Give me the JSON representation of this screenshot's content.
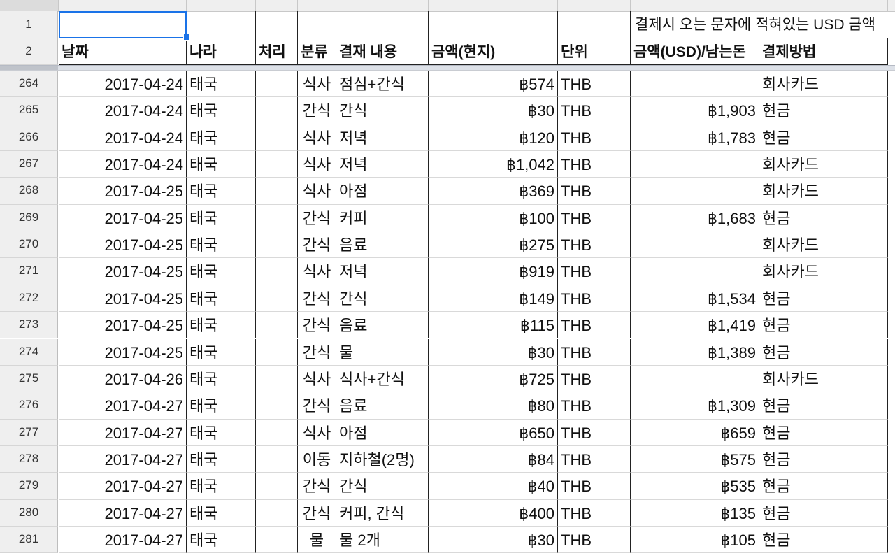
{
  "header_row_numbers": [
    "1",
    "2"
  ],
  "note_row1": "결제시 오는 문자에 적혀있는 USD 금액",
  "columns": [
    "날짜",
    "나라",
    "처리",
    "분류",
    "결재 내용",
    "금액(현지)",
    "단위",
    "금액(USD)/남는돈",
    "결제방법"
  ],
  "rows": [
    {
      "num": "264",
      "date": "2017-04-24",
      "country": "태국",
      "proc": "",
      "cat": "식사",
      "desc": "점심+간식",
      "amount": "฿574",
      "unit": "THB",
      "usd": "",
      "method": "회사카드"
    },
    {
      "num": "265",
      "date": "2017-04-24",
      "country": "태국",
      "proc": "",
      "cat": "간식",
      "desc": "간식",
      "amount": "฿30",
      "unit": "THB",
      "usd": "฿1,903",
      "method": "현금"
    },
    {
      "num": "266",
      "date": "2017-04-24",
      "country": "태국",
      "proc": "",
      "cat": "식사",
      "desc": "저녁",
      "amount": "฿120",
      "unit": "THB",
      "usd": "฿1,783",
      "method": "현금"
    },
    {
      "num": "267",
      "date": "2017-04-24",
      "country": "태국",
      "proc": "",
      "cat": "식사",
      "desc": "저녁",
      "amount": "฿1,042",
      "unit": "THB",
      "usd": "",
      "method": "회사카드"
    },
    {
      "num": "268",
      "date": "2017-04-25",
      "country": "태국",
      "proc": "",
      "cat": "식사",
      "desc": "아점",
      "amount": "฿369",
      "unit": "THB",
      "usd": "",
      "method": "회사카드"
    },
    {
      "num": "269",
      "date": "2017-04-25",
      "country": "태국",
      "proc": "",
      "cat": "간식",
      "desc": "커피",
      "amount": "฿100",
      "unit": "THB",
      "usd": "฿1,683",
      "method": "현금"
    },
    {
      "num": "270",
      "date": "2017-04-25",
      "country": "태국",
      "proc": "",
      "cat": "간식",
      "desc": "음료",
      "amount": "฿275",
      "unit": "THB",
      "usd": "",
      "method": "회사카드"
    },
    {
      "num": "271",
      "date": "2017-04-25",
      "country": "태국",
      "proc": "",
      "cat": "식사",
      "desc": "저녁",
      "amount": "฿919",
      "unit": "THB",
      "usd": "",
      "method": "회사카드"
    },
    {
      "num": "272",
      "date": "2017-04-25",
      "country": "태국",
      "proc": "",
      "cat": "간식",
      "desc": "간식",
      "amount": "฿149",
      "unit": "THB",
      "usd": "฿1,534",
      "method": "현금"
    },
    {
      "num": "273",
      "date": "2017-04-25",
      "country": "태국",
      "proc": "",
      "cat": "간식",
      "desc": "음료",
      "amount": "฿115",
      "unit": "THB",
      "usd": "฿1,419",
      "method": "현금"
    },
    {
      "num": "274",
      "date": "2017-04-25",
      "country": "태국",
      "proc": "",
      "cat": "간식",
      "desc": "물",
      "amount": "฿30",
      "unit": "THB",
      "usd": "฿1,389",
      "method": "현금"
    },
    {
      "num": "275",
      "date": "2017-04-26",
      "country": "태국",
      "proc": "",
      "cat": "식사",
      "desc": "식사+간식",
      "amount": "฿725",
      "unit": "THB",
      "usd": "",
      "method": "회사카드"
    },
    {
      "num": "276",
      "date": "2017-04-27",
      "country": "태국",
      "proc": "",
      "cat": "간식",
      "desc": "음료",
      "amount": "฿80",
      "unit": "THB",
      "usd": "฿1,309",
      "method": "현금"
    },
    {
      "num": "277",
      "date": "2017-04-27",
      "country": "태국",
      "proc": "",
      "cat": "식사",
      "desc": "아점",
      "amount": "฿650",
      "unit": "THB",
      "usd": "฿659",
      "method": "현금"
    },
    {
      "num": "278",
      "date": "2017-04-27",
      "country": "태국",
      "proc": "",
      "cat": "이동",
      "desc": "지하철(2명)",
      "amount": "฿84",
      "unit": "THB",
      "usd": "฿575",
      "method": "현금"
    },
    {
      "num": "279",
      "date": "2017-04-27",
      "country": "태국",
      "proc": "",
      "cat": "간식",
      "desc": "간식",
      "amount": "฿40",
      "unit": "THB",
      "usd": "฿535",
      "method": "현금"
    },
    {
      "num": "280",
      "date": "2017-04-27",
      "country": "태국",
      "proc": "",
      "cat": "간식",
      "desc": "커피, 간식",
      "amount": "฿400",
      "unit": "THB",
      "usd": "฿135",
      "method": "현금"
    },
    {
      "num": "281",
      "date": "2017-04-27",
      "country": "태국",
      "proc": "",
      "cat": "물",
      "desc": "물 2개",
      "amount": "฿30",
      "unit": "THB",
      "usd": "฿105",
      "method": "현금"
    }
  ],
  "colors": {
    "selection": "#1a73e8",
    "header_bg": "#efefef",
    "gridline": "#222222"
  }
}
